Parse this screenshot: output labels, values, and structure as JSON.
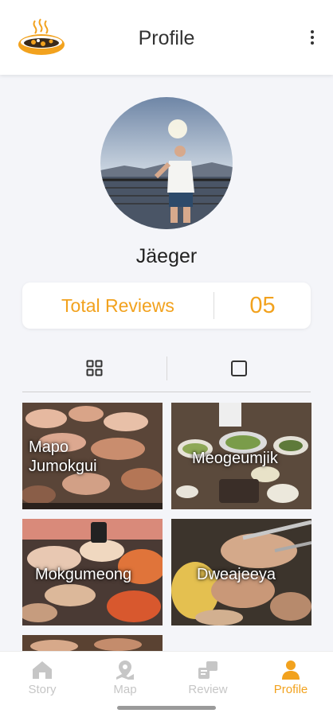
{
  "header": {
    "title": "Profile",
    "logo_icon": "food-bowl-logo",
    "menu_icon": "more-vertical-icon"
  },
  "profile": {
    "username": "Jäeger",
    "avatar_icon": "profile-photo"
  },
  "reviews": {
    "label": "Total Reviews",
    "count": "05"
  },
  "view_toggle": {
    "options": [
      "grid-view-icon",
      "single-view-icon"
    ],
    "selected": "grid-view-icon"
  },
  "restaurants": [
    {
      "name": "Mapo Jumokgui"
    },
    {
      "name": "Meogeumjik"
    },
    {
      "name": "Mokgumeong"
    },
    {
      "name": "Dweajeeya"
    }
  ],
  "nav": {
    "items": [
      {
        "label": "Story",
        "icon": "home-icon"
      },
      {
        "label": "Map",
        "icon": "map-pin-icon"
      },
      {
        "label": "Review",
        "icon": "review-icon"
      },
      {
        "label": "Profile",
        "icon": "person-icon"
      }
    ],
    "active": "Profile"
  },
  "colors": {
    "accent": "#f2a21e",
    "background": "#f4f5f9",
    "inactive": "#c6c6c6"
  }
}
